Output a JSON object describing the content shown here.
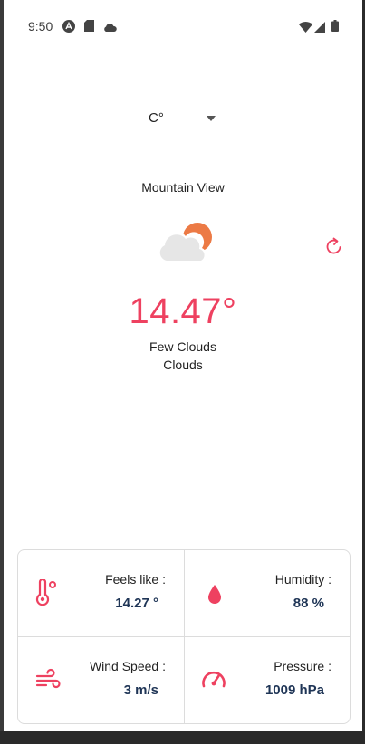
{
  "status_bar": {
    "time": "9:50"
  },
  "unit_select": {
    "selected": "C°"
  },
  "location": {
    "city": "Mountain View"
  },
  "current": {
    "temperature": "14.47°",
    "description": "Few Clouds",
    "main": "Clouds",
    "icon": "partly-cloudy-icon"
  },
  "details": {
    "feels_like": {
      "label": "Feels like :",
      "value": "14.27 °",
      "icon": "thermometer-icon"
    },
    "humidity": {
      "label": "Humidity :",
      "value": "88 %",
      "icon": "water-drop-icon"
    },
    "wind_speed": {
      "label": "Wind Speed :",
      "value": "3 m/s",
      "icon": "wind-icon"
    },
    "pressure": {
      "label": "Pressure :",
      "value": "1009 hPa",
      "icon": "gauge-icon"
    }
  },
  "colors": {
    "accent": "#ee4160",
    "value_text": "#1f3556",
    "sun": "#ec7a45",
    "cloud": "#e6e6e6"
  }
}
